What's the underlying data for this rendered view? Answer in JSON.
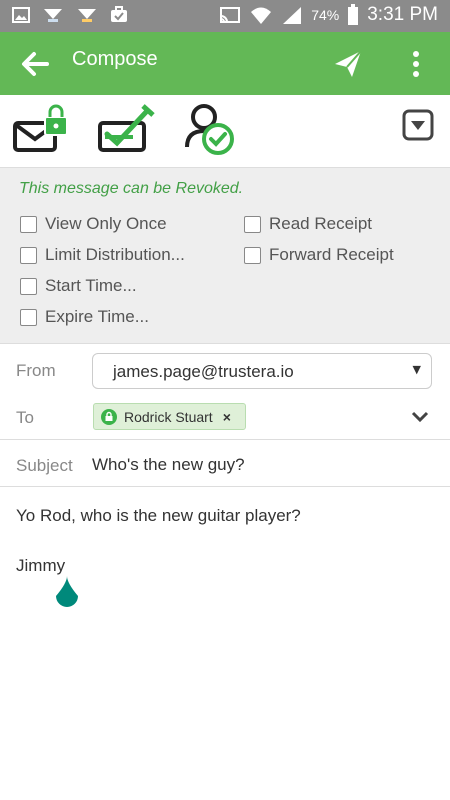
{
  "status_bar": {
    "battery": "74%",
    "time": "3:31 PM",
    "icons": [
      "image-icon",
      "download-icon",
      "download-icon",
      "briefcase-icon",
      "cast-icon",
      "wifi-icon",
      "signal-icon",
      "battery-icon"
    ]
  },
  "app_bar": {
    "title": "Compose",
    "icons": [
      "back-arrow-icon",
      "send-icon",
      "more-vert-icon"
    ],
    "color": "#63b856"
  },
  "toolbar": {
    "icons": [
      "secure-mail-icon",
      "verified-mail-icon",
      "contact-verified-icon",
      "dropdown-toggle-icon"
    ]
  },
  "options": {
    "revoke_note": "This message can be Revoked.",
    "left": [
      {
        "label": "View Only Once",
        "checked": false
      },
      {
        "label": "Limit Distribution...",
        "checked": false
      },
      {
        "label": "Start Time...",
        "checked": false
      },
      {
        "label": "Expire Time...",
        "checked": false
      }
    ],
    "right": [
      {
        "label": "Read Receipt",
        "checked": false
      },
      {
        "label": "Forward Receipt",
        "checked": false
      }
    ]
  },
  "form": {
    "from_label": "From",
    "from_value": "james.page@trustera.io",
    "to_label": "To",
    "recipient": "Rodrick Stuart",
    "remove_symbol": "×",
    "subject_label": "Subject",
    "subject_value": "Who's the new guy?"
  },
  "message": {
    "line1": "Yo Rod, who is the new guitar player?",
    "signature": "Jimmy"
  },
  "colors": {
    "accent": "#63b856",
    "revoke_text": "#43a047",
    "cursor_handle": "#00897b"
  }
}
